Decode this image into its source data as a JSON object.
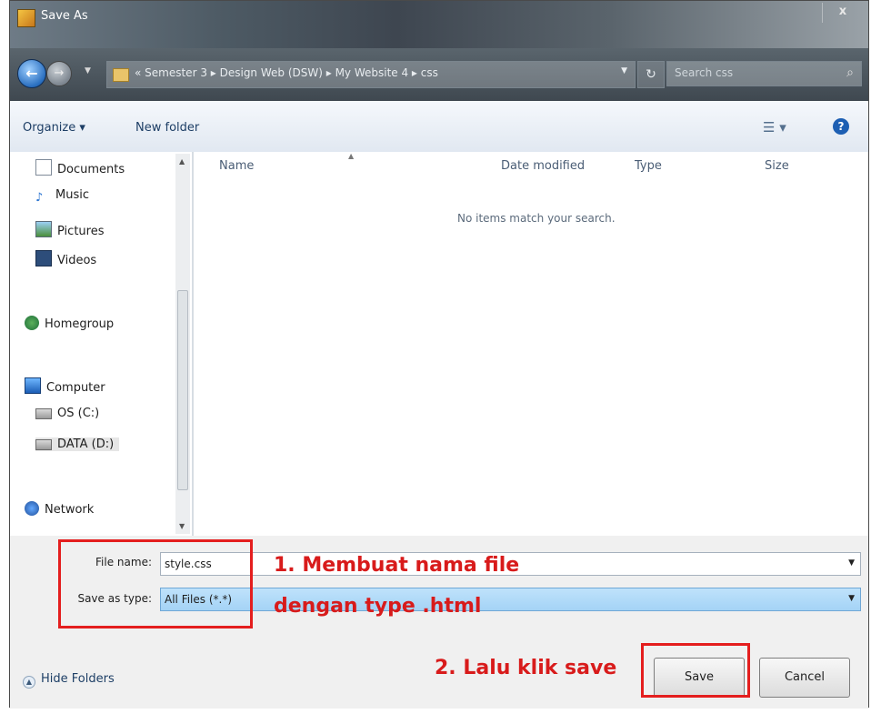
{
  "window": {
    "title": "Save As",
    "close_glyph": "x"
  },
  "address": {
    "path": "« Semester 3  ▸  Design Web (DSW)  ▸  My Website 4  ▸  css",
    "search_placeholder": "Search css"
  },
  "toolbar": {
    "organize_label": "Organize ▾",
    "new_folder_label": "New folder"
  },
  "nav": {
    "items": [
      {
        "label": "Documents",
        "icon": "documents-icon"
      },
      {
        "label": "Music",
        "icon": "music-icon"
      },
      {
        "label": "Pictures",
        "icon": "pictures-icon"
      },
      {
        "label": "Videos",
        "icon": "videos-icon"
      },
      {
        "label": "Homegroup",
        "icon": "homegroup-icon"
      },
      {
        "label": "Computer",
        "icon": "computer-icon"
      },
      {
        "label": "OS (C:)",
        "icon": "drive-icon"
      },
      {
        "label": "DATA (D:)",
        "icon": "drive-icon"
      },
      {
        "label": "Network",
        "icon": "network-icon"
      }
    ]
  },
  "files": {
    "columns": [
      "Name",
      "Date modified",
      "Type",
      "Size"
    ],
    "empty_message": "No items match your search."
  },
  "form": {
    "file_name_label": "File name:",
    "file_name_value": "style.css",
    "save_type_label": "Save as type:",
    "save_type_value": "All Files (*.*)"
  },
  "footer": {
    "hide_folders_label": "Hide Folders",
    "save_label": "Save",
    "cancel_label": "Cancel"
  },
  "annotations": {
    "step1_line1": "1. Membuat nama file",
    "step1_line2": "dengan type .html",
    "step2": "2. Lalu klik save",
    "color": "#e41e1e"
  }
}
